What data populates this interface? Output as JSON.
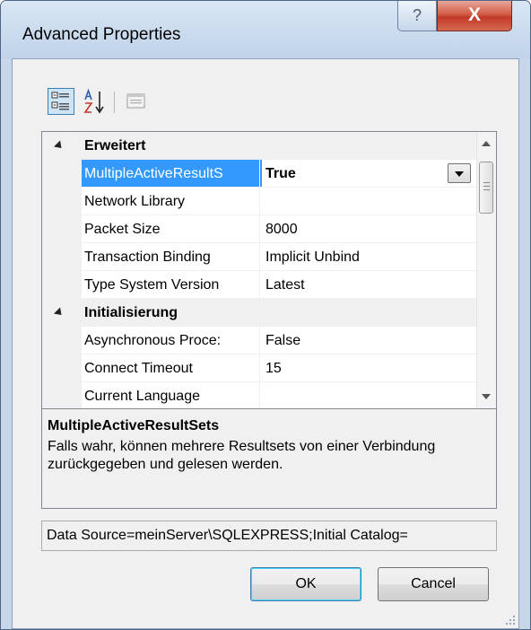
{
  "window": {
    "title": "Advanced Properties",
    "help_glyph": "?",
    "close_glyph": "X"
  },
  "toolbar": {
    "categorized": "categorized-icon",
    "alphabetical": "sort-alphabetical-icon",
    "property_pages": "property-pages-icon"
  },
  "grid": {
    "rows": [
      {
        "kind": "category",
        "label": "Erweitert"
      },
      {
        "kind": "property",
        "name": "MultipleActiveResultS",
        "value": "True",
        "selected": true
      },
      {
        "kind": "property",
        "name": "Network Library",
        "value": ""
      },
      {
        "kind": "property",
        "name": "Packet Size",
        "value": "8000"
      },
      {
        "kind": "property",
        "name": "Transaction Binding",
        "value": "Implicit Unbind"
      },
      {
        "kind": "property",
        "name": "Type System Version",
        "value": "Latest"
      },
      {
        "kind": "category",
        "label": "Initialisierung"
      },
      {
        "kind": "property",
        "name": "Asynchronous Proce:",
        "value": "False"
      },
      {
        "kind": "property",
        "name": "Connect Timeout",
        "value": "15"
      },
      {
        "kind": "property",
        "name": "Current Language",
        "value": ""
      }
    ]
  },
  "description": {
    "title": "MultipleActiveResultSets",
    "text": "Falls wahr, können mehrere Resultsets von einer Verbindung zurückgegeben und gelesen werden."
  },
  "connection_string": "Data Source=meinServer\\SQLEXPRESS;Initial Catalog=",
  "buttons": {
    "ok": "OK",
    "cancel": "Cancel"
  },
  "colors": {
    "selection": "#3399ff",
    "close_button": "#c2392a"
  }
}
